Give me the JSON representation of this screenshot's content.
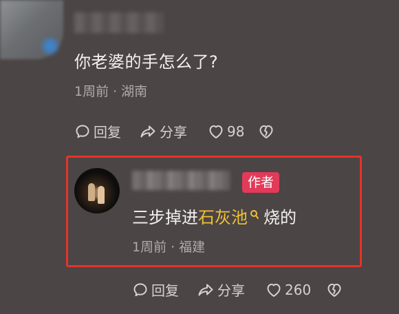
{
  "comment": {
    "text": "你老婆的手怎么了?",
    "time": "1周前",
    "location": "湖南",
    "reply_label": "回复",
    "share_label": "分享",
    "like_count": "98"
  },
  "reply": {
    "author_badge": "作者",
    "text_prefix": "三步掉进",
    "keyword": "石灰池",
    "text_suffix": "烧的",
    "time": "1周前",
    "location": "福建",
    "reply_label": "回复",
    "share_label": "分享",
    "like_count": "260"
  },
  "colors": {
    "highlight_border": "#e6322a",
    "author_badge": "#e23a58",
    "keyword": "#f2c033",
    "background": "#4b4545"
  },
  "icons": {
    "reply": "speech-bubble-icon",
    "share": "share-arrow-icon",
    "like": "heart-icon",
    "dislike": "broken-heart-icon",
    "keyword": "search-icon"
  }
}
